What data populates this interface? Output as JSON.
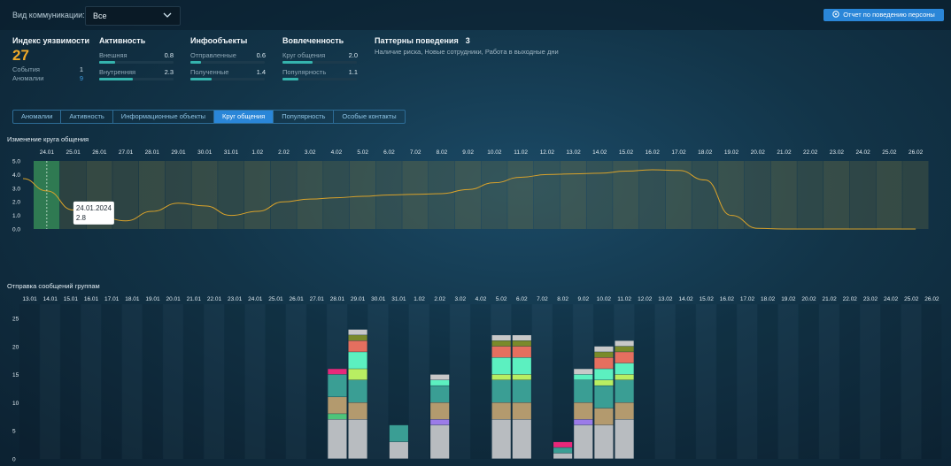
{
  "header": {
    "comm_label": "Вид коммуникации:",
    "comm_value": "Все",
    "report_button": "Отчет по поведению персоны"
  },
  "metrics": {
    "index": {
      "title": "Индекс уязвимости",
      "value": "27",
      "events_label": "События",
      "events_value": "1",
      "anomalies_label": "Аномалии",
      "anomalies_value": "9"
    },
    "activity": {
      "title": "Активность",
      "rows": [
        {
          "label": "Внешняя",
          "value": "0.8",
          "fill": 0.22
        },
        {
          "label": "Внутренняя",
          "value": "2.3",
          "fill": 0.45
        }
      ]
    },
    "infoobjects": {
      "title": "Инфообъекты",
      "rows": [
        {
          "label": "Отправленные",
          "value": "0.6",
          "fill": 0.14
        },
        {
          "label": "Полученные",
          "value": "1.4",
          "fill": 0.28
        }
      ]
    },
    "involvement": {
      "title": "Вовлеченность",
      "rows": [
        {
          "label": "Круг общения",
          "value": "2.0",
          "fill": 0.4
        },
        {
          "label": "Популярность",
          "value": "1.1",
          "fill": 0.22
        }
      ]
    },
    "patterns": {
      "title": "Паттерны поведения",
      "count": "3",
      "text": "Наличие риска, Новые сотрудники, Работа в выходные дни"
    }
  },
  "tabs": [
    {
      "label": "Аномалии",
      "active": false
    },
    {
      "label": "Активность",
      "active": false
    },
    {
      "label": "Информационные объекты",
      "active": false
    },
    {
      "label": "Круг общения",
      "active": true
    },
    {
      "label": "Популярность",
      "active": false
    },
    {
      "label": "Особые контакты",
      "active": false
    }
  ],
  "chart_data": [
    {
      "type": "area",
      "title": "Изменение круга общения",
      "categories": [
        "24.01",
        "25.01",
        "26.01",
        "27.01",
        "28.01",
        "29.01",
        "30.01",
        "31.01",
        "1.02",
        "2.02",
        "3.02",
        "4.02",
        "5.02",
        "6.02",
        "7.02",
        "8.02",
        "9.02",
        "10.02",
        "11.02",
        "12.02",
        "13.02",
        "14.02",
        "15.02",
        "16.02",
        "17.02",
        "18.02",
        "19.02",
        "20.02",
        "21.02",
        "22.02",
        "23.02",
        "24.02",
        "25.02",
        "26.02"
      ],
      "values": [
        2.8,
        1.4,
        0.9,
        0.6,
        1.3,
        1.9,
        1.7,
        1.0,
        1.3,
        2.0,
        2.2,
        2.3,
        2.4,
        2.5,
        2.55,
        2.6,
        2.9,
        3.4,
        3.8,
        4.0,
        4.05,
        4.1,
        4.25,
        4.35,
        4.3,
        3.6,
        1.0,
        0.05,
        0.0,
        0.0,
        0.0,
        0.0,
        0.0,
        0.0
      ],
      "ylim": [
        0,
        5
      ],
      "yticks": [
        "0.0",
        "1.0",
        "2.0",
        "3.0",
        "4.0",
        "5.0"
      ],
      "highlight_index": 0,
      "tooltip": {
        "date": "24.01.2024",
        "value": "2.8"
      },
      "line_color": "#d9a22a",
      "grid": false
    },
    {
      "type": "bar",
      "stacked": true,
      "title": "Отправка сообщений группам",
      "categories": [
        "13.01",
        "14.01",
        "15.01",
        "16.01",
        "17.01",
        "18.01",
        "19.01",
        "20.01",
        "21.01",
        "22.01",
        "23.01",
        "24.01",
        "25.01",
        "26.01",
        "27.01",
        "28.01",
        "29.01",
        "30.01",
        "31.01",
        "1.02",
        "2.02",
        "3.02",
        "4.02",
        "5.02",
        "6.02",
        "7.02",
        "8.02",
        "9.02",
        "10.02",
        "11.02",
        "12.02",
        "13.02",
        "14.02",
        "15.02",
        "16.02",
        "17.02",
        "18.02",
        "19.02",
        "20.02",
        "21.02",
        "22.02",
        "23.02",
        "24.02",
        "25.02",
        "26.02"
      ],
      "ylim": [
        0,
        25
      ],
      "yticks": [
        "0",
        "5",
        "10",
        "15",
        "20",
        "25"
      ],
      "segment_colors": [
        "#b8bcc0",
        "#4fc47a",
        "#9b7be8",
        "#b39a6e",
        "#3a9e94",
        "#e8287a",
        "#b8ee62",
        "#5cf0c0",
        "#e56f5f",
        "#7a8a2a",
        "#c8c8c8"
      ],
      "series": [
        {
          "values": [
            0,
            0,
            0,
            0,
            0,
            0,
            0,
            0,
            0,
            0,
            0,
            0,
            0,
            0,
            0,
            7,
            7,
            0,
            3,
            0,
            6,
            0,
            0,
            7,
            7,
            0,
            1,
            6,
            6,
            7,
            0,
            0,
            0,
            0,
            0,
            0,
            0,
            0,
            0,
            0,
            0,
            0,
            0,
            0,
            0
          ]
        },
        {
          "values": [
            0,
            0,
            0,
            0,
            0,
            0,
            0,
            0,
            0,
            0,
            0,
            0,
            0,
            0,
            0,
            1,
            0,
            0,
            0,
            0,
            0,
            0,
            0,
            0,
            0,
            0,
            0,
            0,
            0,
            0,
            0,
            0,
            0,
            0,
            0,
            0,
            0,
            0,
            0,
            0,
            0,
            0,
            0,
            0,
            0
          ]
        },
        {
          "values": [
            0,
            0,
            0,
            0,
            0,
            0,
            0,
            0,
            0,
            0,
            0,
            0,
            0,
            0,
            0,
            0,
            0,
            0,
            0,
            0,
            1,
            0,
            0,
            0,
            0,
            0,
            0,
            1,
            0,
            0,
            0,
            0,
            0,
            0,
            0,
            0,
            0,
            0,
            0,
            0,
            0,
            0,
            0,
            0,
            0
          ]
        },
        {
          "values": [
            0,
            0,
            0,
            0,
            0,
            0,
            0,
            0,
            0,
            0,
            0,
            0,
            0,
            0,
            0,
            3,
            3,
            0,
            0,
            0,
            3,
            0,
            0,
            3,
            3,
            0,
            0,
            3,
            3,
            3,
            0,
            0,
            0,
            0,
            0,
            0,
            0,
            0,
            0,
            0,
            0,
            0,
            0,
            0,
            0
          ]
        },
        {
          "values": [
            0,
            0,
            0,
            0,
            0,
            0,
            0,
            0,
            0,
            0,
            0,
            0,
            0,
            0,
            0,
            4,
            4,
            0,
            3,
            0,
            3,
            0,
            0,
            4,
            4,
            0,
            1,
            4,
            4,
            4,
            0,
            0,
            0,
            0,
            0,
            0,
            0,
            0,
            0,
            0,
            0,
            0,
            0,
            0,
            0
          ]
        },
        {
          "values": [
            0,
            0,
            0,
            0,
            0,
            0,
            0,
            0,
            0,
            0,
            0,
            0,
            0,
            0,
            0,
            1,
            0,
            0,
            0,
            0,
            0,
            0,
            0,
            0,
            0,
            0,
            1,
            0,
            0,
            0,
            0,
            0,
            0,
            0,
            0,
            0,
            0,
            0,
            0,
            0,
            0,
            0,
            0,
            0,
            0
          ]
        },
        {
          "values": [
            0,
            0,
            0,
            0,
            0,
            0,
            0,
            0,
            0,
            0,
            0,
            0,
            0,
            0,
            0,
            0,
            2,
            0,
            0,
            0,
            0,
            0,
            0,
            1,
            1,
            0,
            0,
            0,
            1,
            1,
            0,
            0,
            0,
            0,
            0,
            0,
            0,
            0,
            0,
            0,
            0,
            0,
            0,
            0,
            0
          ]
        },
        {
          "values": [
            0,
            0,
            0,
            0,
            0,
            0,
            0,
            0,
            0,
            0,
            0,
            0,
            0,
            0,
            0,
            0,
            3,
            0,
            0,
            0,
            1,
            0,
            0,
            3,
            3,
            0,
            0,
            1,
            2,
            2,
            0,
            0,
            0,
            0,
            0,
            0,
            0,
            0,
            0,
            0,
            0,
            0,
            0,
            0,
            0
          ]
        },
        {
          "values": [
            0,
            0,
            0,
            0,
            0,
            0,
            0,
            0,
            0,
            0,
            0,
            0,
            0,
            0,
            0,
            0,
            2,
            0,
            0,
            0,
            0,
            0,
            0,
            2,
            2,
            0,
            0,
            0,
            2,
            2,
            0,
            0,
            0,
            0,
            0,
            0,
            0,
            0,
            0,
            0,
            0,
            0,
            0,
            0,
            0
          ]
        },
        {
          "values": [
            0,
            0,
            0,
            0,
            0,
            0,
            0,
            0,
            0,
            0,
            0,
            0,
            0,
            0,
            0,
            0,
            1,
            0,
            0,
            0,
            0,
            0,
            0,
            1,
            1,
            0,
            0,
            0,
            1,
            1,
            0,
            0,
            0,
            0,
            0,
            0,
            0,
            0,
            0,
            0,
            0,
            0,
            0,
            0,
            0
          ]
        },
        {
          "values": [
            0,
            0,
            0,
            0,
            0,
            0,
            0,
            0,
            0,
            0,
            0,
            0,
            0,
            0,
            0,
            0,
            1,
            0,
            0,
            0,
            1,
            0,
            0,
            1,
            1,
            0,
            0,
            1,
            1,
            1,
            0,
            0,
            0,
            0,
            0,
            0,
            0,
            0,
            0,
            0,
            0,
            0,
            0,
            0,
            0
          ]
        }
      ],
      "totals": [
        0,
        0,
        0,
        0,
        0,
        0,
        0,
        0,
        0,
        0,
        0,
        0,
        0,
        0,
        0,
        16,
        23,
        0,
        6,
        0,
        15,
        0,
        0,
        23,
        23,
        0,
        3,
        15,
        23,
        22,
        0,
        0,
        0,
        0,
        0,
        0,
        0,
        0,
        0,
        0,
        0,
        0,
        0,
        0,
        0
      ]
    }
  ]
}
